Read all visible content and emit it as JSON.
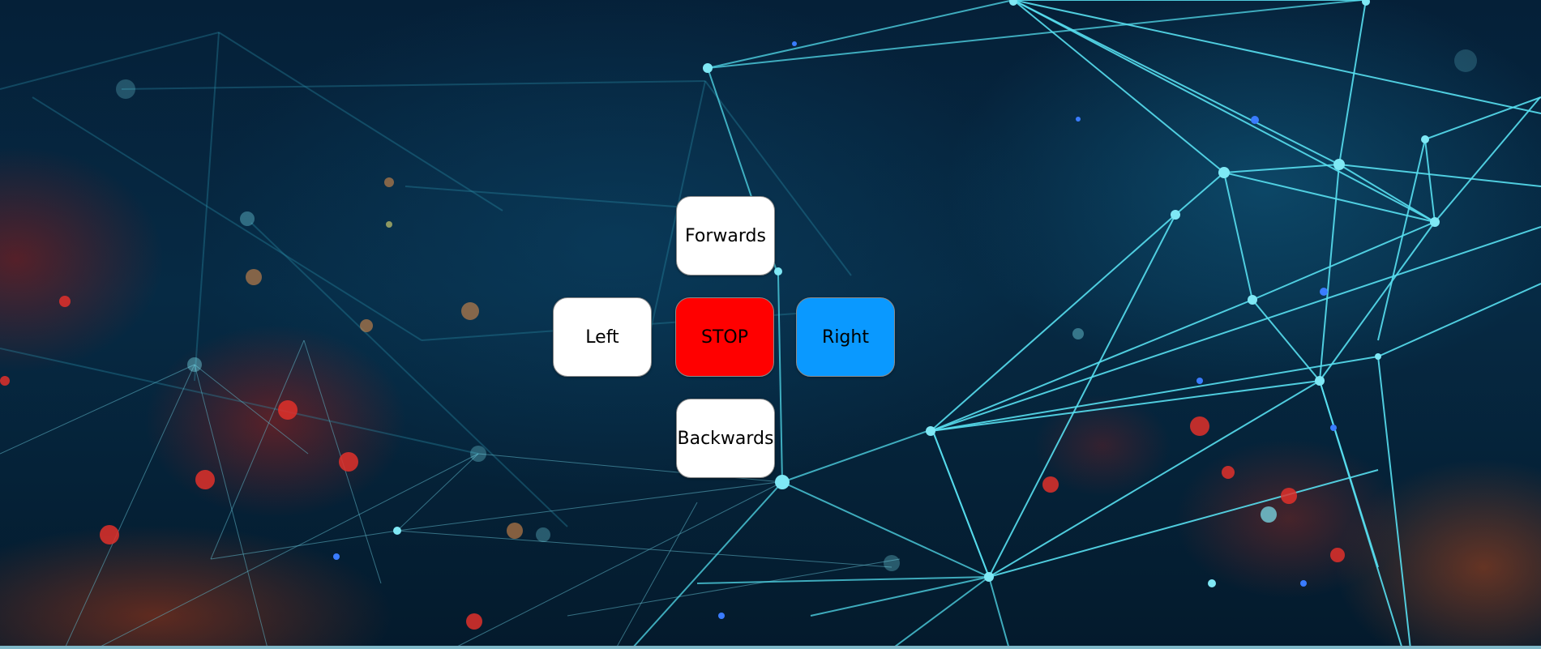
{
  "controls": {
    "forwards_label": "Forwards",
    "left_label": "Left",
    "stop_label": "STOP",
    "right_label": "Right",
    "backwards_label": "Backwards"
  },
  "background": {
    "description_icon": "network-background",
    "colors": {
      "base": "#052038",
      "line": "#3fd0e6",
      "glow_red": "#c0281e",
      "glow_orange": "#c85a1e"
    }
  },
  "colors": {
    "forwards": "#ffffff",
    "left": "#ffffff",
    "stop": "#ff0000",
    "right": "#0a99ff",
    "backwards": "#ffffff",
    "text": "#000000"
  }
}
